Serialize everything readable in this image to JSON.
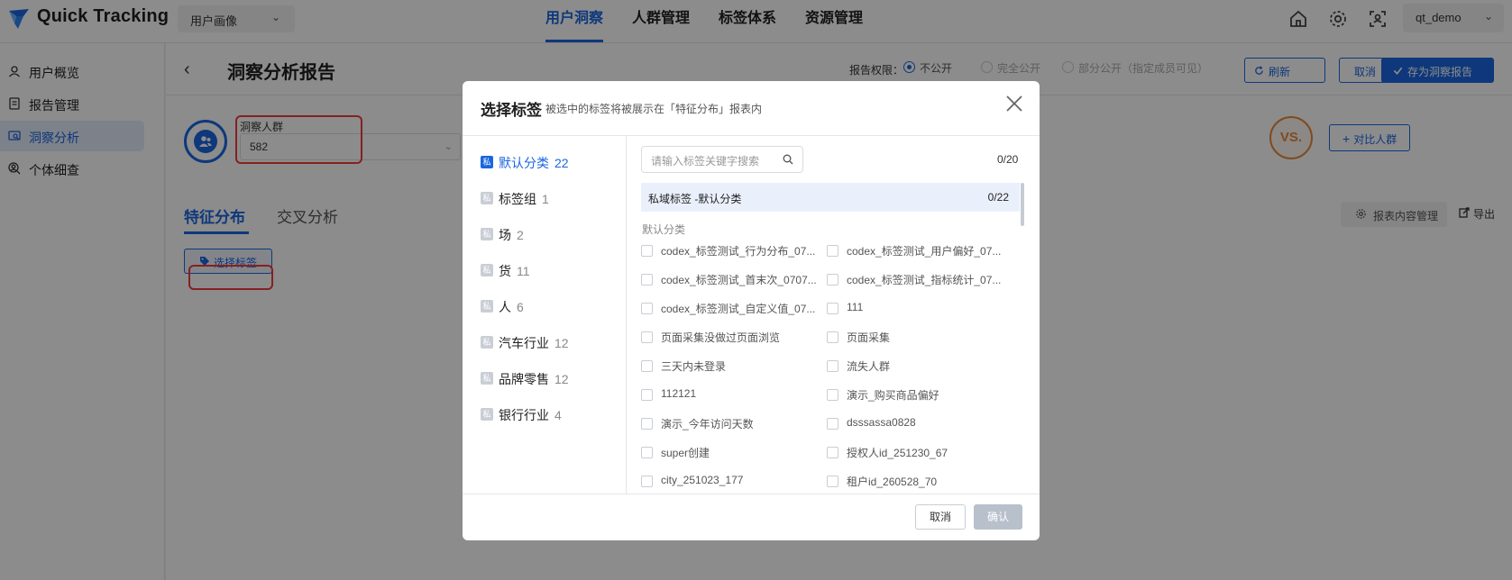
{
  "header": {
    "brand": "Quick Tracking",
    "product_select": "用户画像",
    "nav": [
      "用户洞察",
      "人群管理",
      "标签体系",
      "资源管理"
    ],
    "user": "qt_demo",
    "icons": [
      "home-icon",
      "gear-icon",
      "scan-icon"
    ]
  },
  "sidebar": {
    "items": [
      {
        "label": "用户概览",
        "icon": "user-icon"
      },
      {
        "label": "报告管理",
        "icon": "report-icon"
      },
      {
        "label": "洞察分析",
        "icon": "insight-icon"
      },
      {
        "label": "个体细查",
        "icon": "person-search-icon"
      }
    ]
  },
  "page": {
    "title": "洞察分析报告",
    "permission_label": "报告权限：",
    "permission_options": [
      "不公开",
      "完全公开",
      "部分公开（指定成员可见）"
    ],
    "refresh": "刷新",
    "cancel": "取消",
    "save": "存为洞察报告"
  },
  "content": {
    "crowd_label": "洞察人群",
    "crowd_value": "582",
    "vs": "VS.",
    "compare": "对比人群",
    "tabs": [
      "特征分布",
      "交叉分析"
    ],
    "select_tag": "选择标签",
    "report_mgr": "报表内容管理",
    "export": "导出"
  },
  "modal": {
    "title": "选择标签",
    "subtitle": "被选中的标签将被展示在「特征分布」报表内",
    "badge": "私",
    "categories": [
      {
        "name": "默认分类",
        "count": "22"
      },
      {
        "name": "标签组",
        "count": "1"
      },
      {
        "name": "场",
        "count": "2"
      },
      {
        "name": "货",
        "count": "11"
      },
      {
        "name": "人",
        "count": "6"
      },
      {
        "name": "汽车行业",
        "count": "12"
      },
      {
        "name": "品牌零售",
        "count": "12"
      },
      {
        "name": "银行行业",
        "count": "4"
      }
    ],
    "search_placeholder": "请输入标签关键字搜索",
    "selected_count": "0/20",
    "group_title": "私域标签 -默认分类",
    "group_count": "0/22",
    "sub_label": "默认分类",
    "options": [
      "codex_标签测试_行为分布_07...",
      "codex_标签测试_用户偏好_07...",
      "codex_标签测试_首末次_0707...",
      "codex_标签测试_指标统计_07...",
      "codex_标签测试_自定义值_07...",
      "111",
      "页面采集没做过页面浏览",
      "页面采集",
      "三天内未登录",
      "流失人群",
      "112121",
      "演示_购买商品偏好",
      "演示_今年访问天数",
      "dsssassa0828",
      "super创建",
      "授权人id_251230_67",
      "city_251023_177",
      "租户id_260528_70"
    ],
    "cancel": "取消",
    "confirm": "确认"
  }
}
